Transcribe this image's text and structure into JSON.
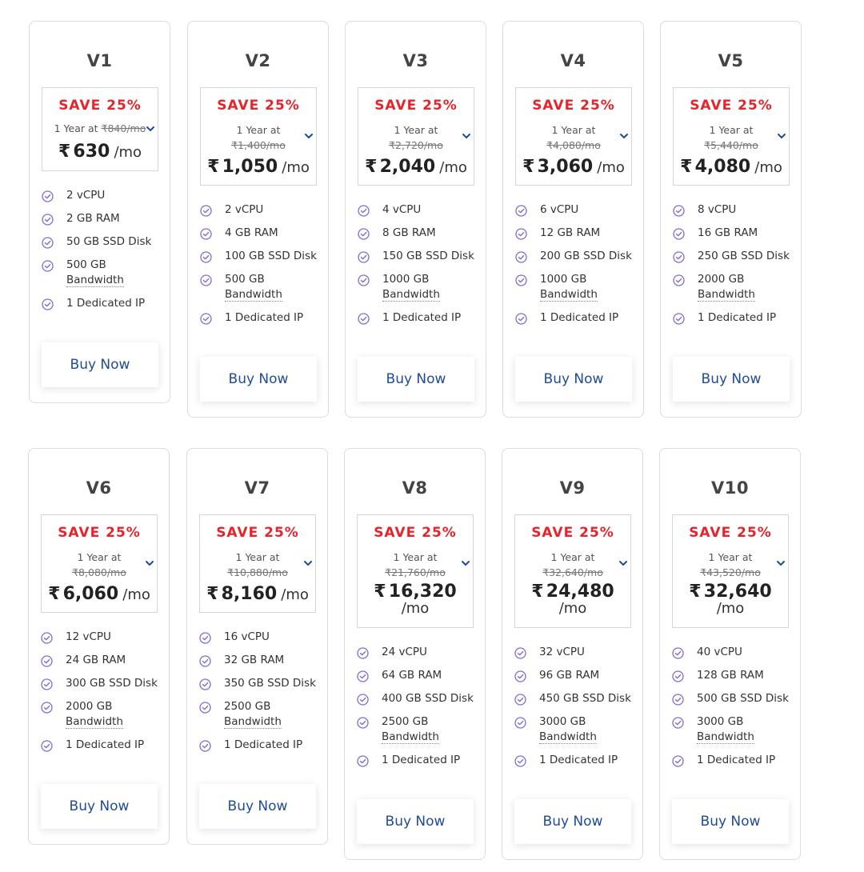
{
  "colors": {
    "save": "#e8232a",
    "accent": "#1f4b99",
    "check": "#7a6fd6"
  },
  "plans": [
    {
      "name": "V1",
      "save": "SAVE 25%",
      "year_label": "1 Year at",
      "old_price": "₹840/mo",
      "currency": "₹",
      "price": "630",
      "unit": "/mo",
      "features": [
        "2 vCPU",
        "2 GB RAM",
        "50 GB SSD Disk",
        "500 GB",
        "Bandwidth",
        "1 Dedicated IP"
      ],
      "buy": "Buy Now"
    },
    {
      "name": "V2",
      "save": "SAVE 25%",
      "year_label": "1 Year at",
      "old_price": "₹1,400/mo",
      "currency": "₹",
      "price": "1,050",
      "unit": "/mo",
      "features": [
        "2 vCPU",
        "4 GB RAM",
        "100 GB SSD Disk",
        "500 GB",
        "Bandwidth",
        "1 Dedicated IP"
      ],
      "buy": "Buy Now"
    },
    {
      "name": "V3",
      "save": "SAVE 25%",
      "year_label": "1 Year at",
      "old_price": "₹2,720/mo",
      "currency": "₹",
      "price": "2,040",
      "unit": "/mo",
      "features": [
        "4 vCPU",
        "8 GB RAM",
        "150 GB SSD Disk",
        "1000 GB",
        "Bandwidth",
        "1 Dedicated IP"
      ],
      "buy": "Buy Now"
    },
    {
      "name": "V4",
      "save": "SAVE 25%",
      "year_label": "1 Year at",
      "old_price": "₹4,080/mo",
      "currency": "₹",
      "price": "3,060",
      "unit": "/mo",
      "features": [
        "6 vCPU",
        "12 GB RAM",
        "200 GB SSD Disk",
        "1000 GB",
        "Bandwidth",
        "1 Dedicated IP"
      ],
      "buy": "Buy Now"
    },
    {
      "name": "V5",
      "save": "SAVE 25%",
      "year_label": "1 Year at",
      "old_price": "₹5,440/mo",
      "currency": "₹",
      "price": "4,080",
      "unit": "/mo",
      "features": [
        "8 vCPU",
        "16 GB RAM",
        "250 GB SSD Disk",
        "2000 GB",
        "Bandwidth",
        "1 Dedicated IP"
      ],
      "buy": "Buy Now"
    },
    {
      "name": "V6",
      "save": "SAVE 25%",
      "year_label": "1 Year at",
      "old_price": "₹8,080/mo",
      "currency": "₹",
      "price": "6,060",
      "unit": "/mo",
      "features": [
        "12 vCPU",
        "24 GB RAM",
        "300 GB SSD Disk",
        "2000 GB",
        "Bandwidth",
        "1 Dedicated IP"
      ],
      "buy": "Buy Now"
    },
    {
      "name": "V7",
      "save": "SAVE 25%",
      "year_label": "1 Year at",
      "old_price": "₹10,880/mo",
      "currency": "₹",
      "price": "8,160",
      "unit": "/mo",
      "features": [
        "16 vCPU",
        "32 GB RAM",
        "350 GB SSD Disk",
        "2500 GB",
        "Bandwidth",
        "1 Dedicated IP"
      ],
      "buy": "Buy Now"
    },
    {
      "name": "V8",
      "save": "SAVE 25%",
      "year_label": "1 Year at",
      "old_price": "₹21,760/mo",
      "currency": "₹",
      "price": "16,320",
      "unit": "/mo",
      "features": [
        "24 vCPU",
        "64 GB RAM",
        "400 GB SSD Disk",
        "2500 GB",
        "Bandwidth",
        "1 Dedicated IP"
      ],
      "buy": "Buy Now"
    },
    {
      "name": "V9",
      "save": "SAVE 25%",
      "year_label": "1 Year at",
      "old_price": "₹32,640/mo",
      "currency": "₹",
      "price": "24,480",
      "unit": "/mo",
      "features": [
        "32 vCPU",
        "96 GB RAM",
        "450 GB SSD Disk",
        "3000 GB",
        "Bandwidth",
        "1 Dedicated IP"
      ],
      "buy": "Buy Now"
    },
    {
      "name": "V10",
      "save": "SAVE 25%",
      "year_label": "1 Year at",
      "old_price": "₹43,520/mo",
      "currency": "₹",
      "price": "32,640",
      "unit": "/mo",
      "features": [
        "40 vCPU",
        "128 GB RAM",
        "500 GB SSD Disk",
        "3000 GB",
        "Bandwidth",
        "1 Dedicated IP"
      ],
      "buy": "Buy Now"
    }
  ]
}
